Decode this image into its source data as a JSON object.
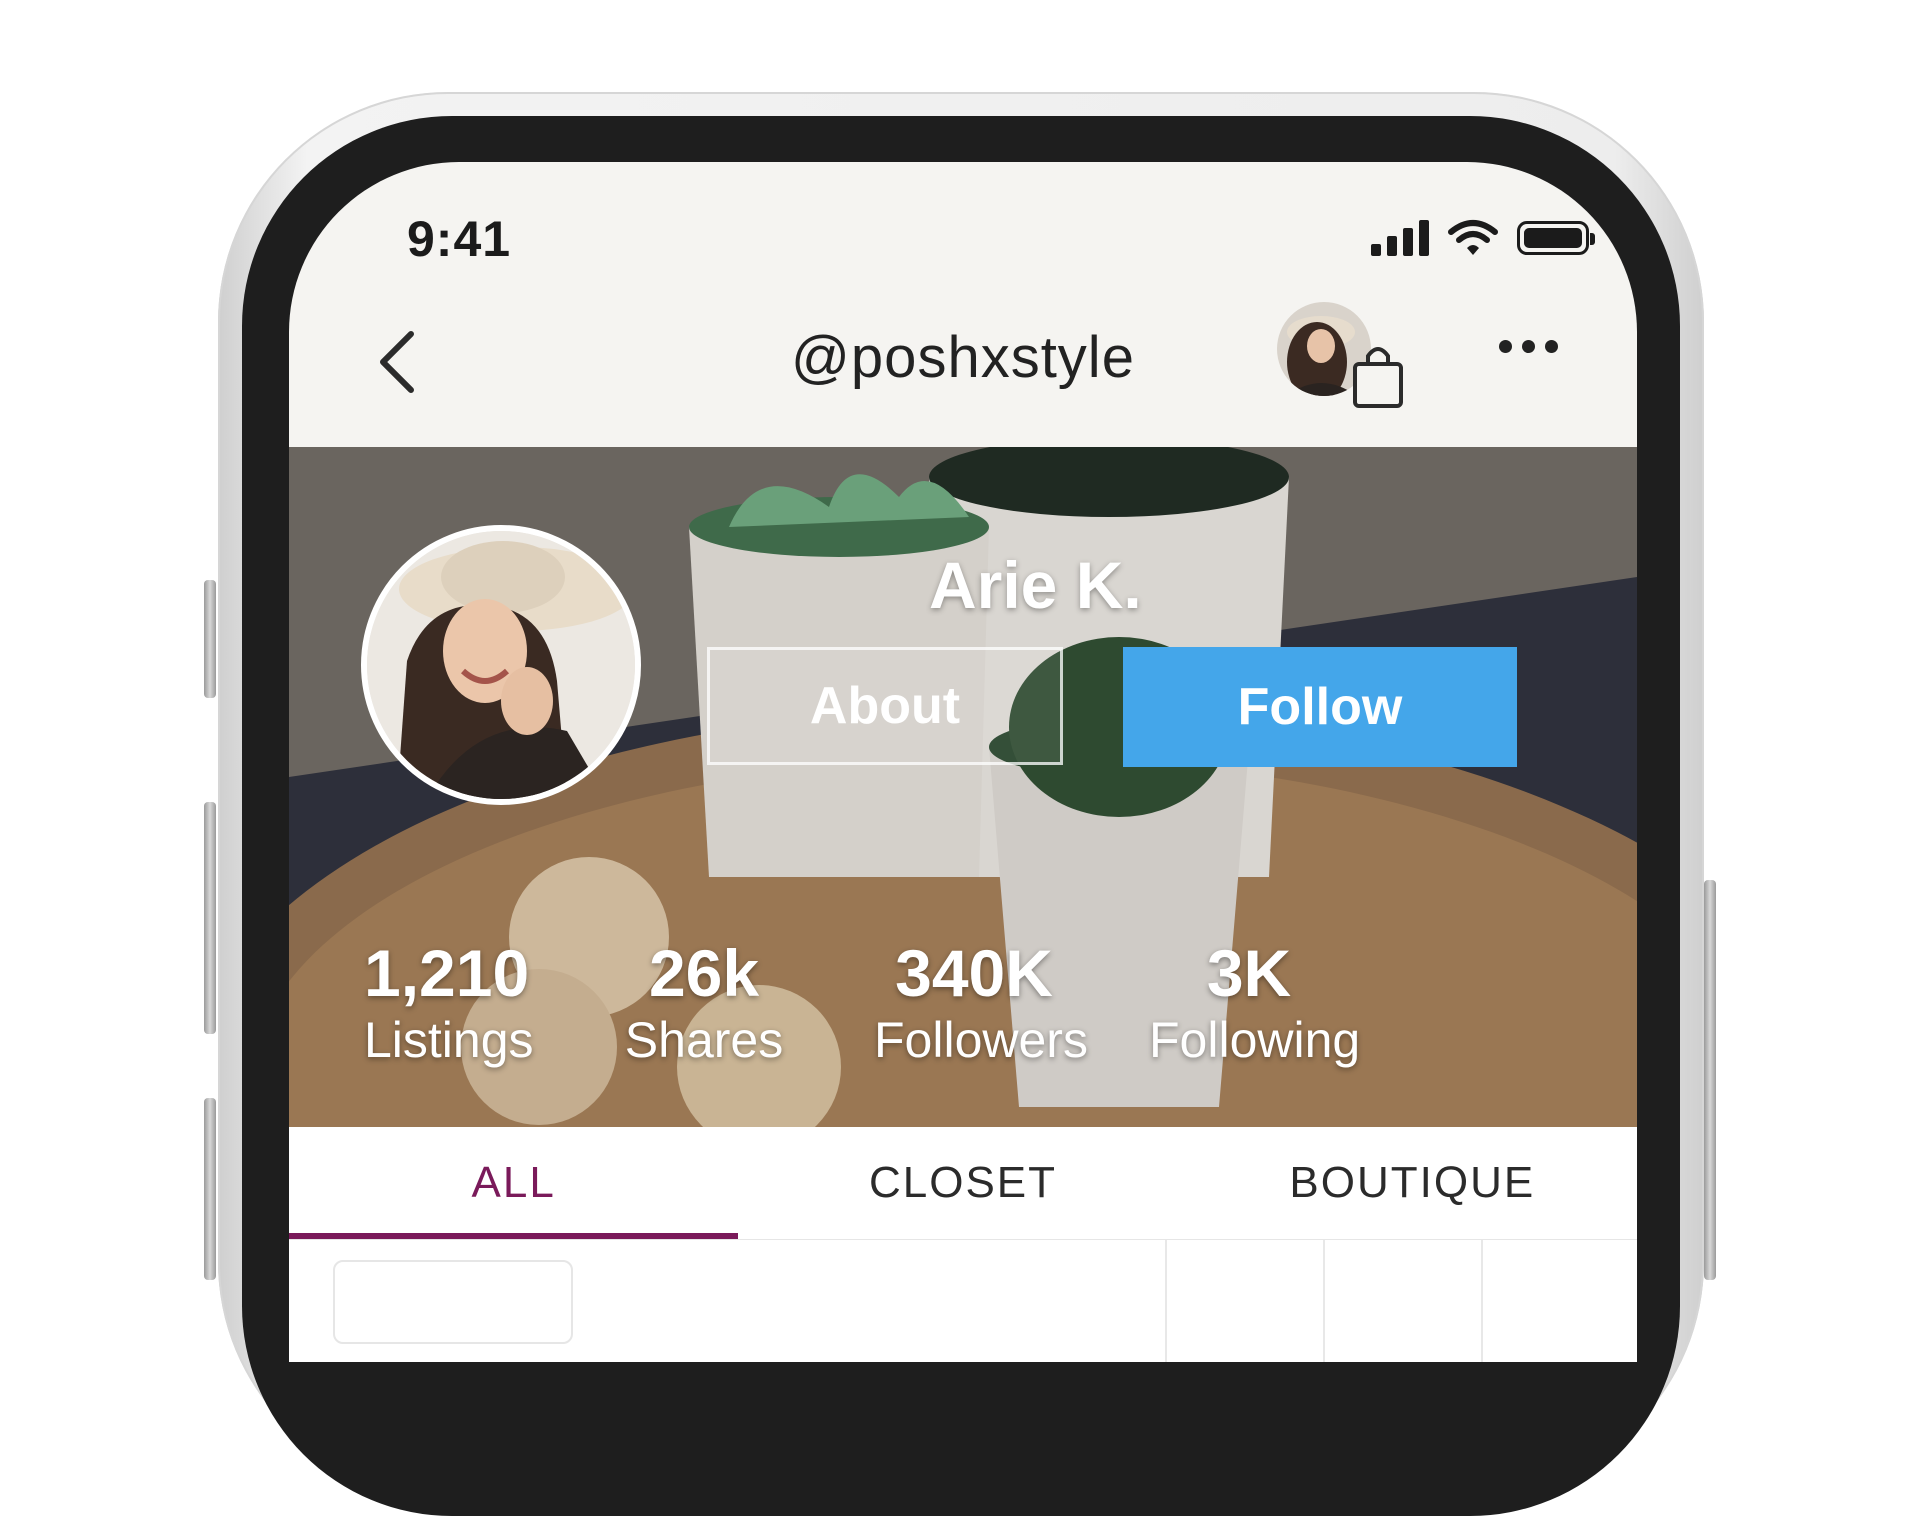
{
  "status_bar": {
    "time": "9:41"
  },
  "nav": {
    "title": "@poshxstyle"
  },
  "profile": {
    "name": "Arie K."
  },
  "actions": {
    "about_label": "About",
    "follow_label": "Follow",
    "follow_color": "#44a6ea"
  },
  "stats": [
    {
      "value": "1,210",
      "label": "Listings"
    },
    {
      "value": "26k",
      "label": "Shares"
    },
    {
      "value": "340K",
      "label": "Followers"
    },
    {
      "value": "3K",
      "label": "Following"
    }
  ],
  "tabs": [
    {
      "label": "ALL",
      "active": true
    },
    {
      "label": "CLOSET",
      "active": false
    },
    {
      "label": "BOUTIQUE",
      "active": false
    }
  ],
  "colors": {
    "accent": "#7a1a5a"
  },
  "icons": [
    "back-chevron-icon",
    "shopping-bag-icon",
    "more-icon",
    "signal-icon",
    "wifi-icon",
    "battery-icon"
  ]
}
